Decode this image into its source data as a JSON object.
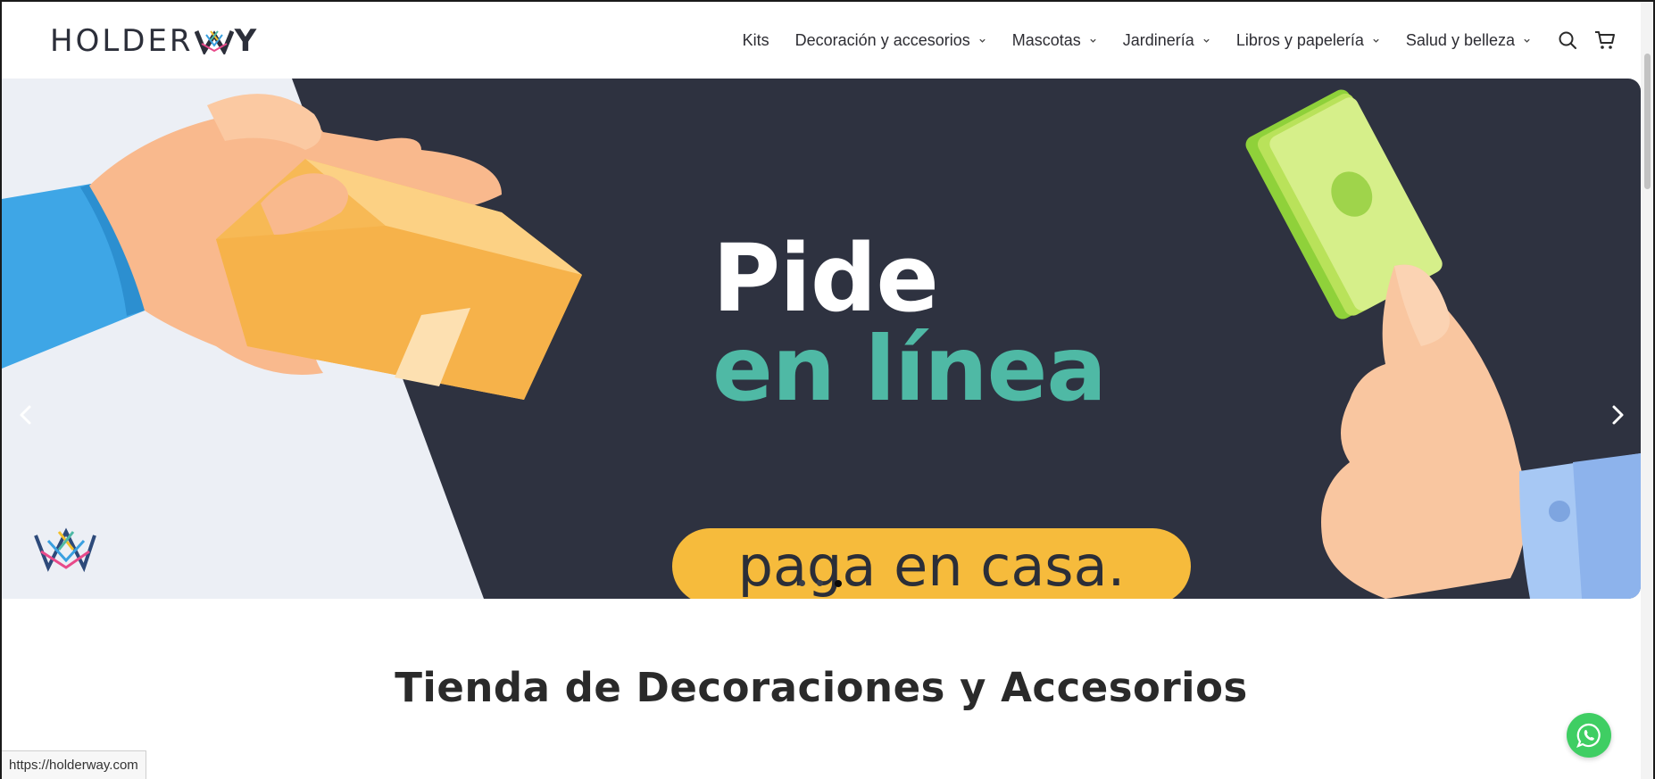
{
  "brand": {
    "logo_text_left": "HOLDER",
    "logo_text_right": "Y",
    "logo_icon": "crown-logo-icon",
    "logo_alt": "HOLDERWAY"
  },
  "nav": {
    "items": [
      {
        "label": "Kits",
        "has_dropdown": false
      },
      {
        "label": "Decoración y accesorios",
        "has_dropdown": true
      },
      {
        "label": "Mascotas",
        "has_dropdown": true
      },
      {
        "label": "Jardinería",
        "has_dropdown": true
      },
      {
        "label": "Libros y papelería",
        "has_dropdown": true
      },
      {
        "label": "Salud y belleza",
        "has_dropdown": true
      }
    ],
    "search_icon": "search-icon",
    "cart_icon": "cart-icon"
  },
  "hero": {
    "line1": "Pide",
    "line2": "en línea",
    "pill_text": "paga en casa.",
    "prev_icon": "chevron-left-icon",
    "next_icon": "chevron-right-icon",
    "slides_count": 3,
    "active_slide": 3,
    "colors": {
      "dark_bg": "#2e3240",
      "light_bg": "#eceff5",
      "accent_teal": "#4fb9a5",
      "pill_yellow": "#f6bb3c"
    }
  },
  "section": {
    "title": "Tienda de Decoraciones y Accesorios"
  },
  "status_bar": {
    "url": "https://holderway.com"
  },
  "whatsapp": {
    "icon": "whatsapp-icon",
    "color": "#3fce63"
  }
}
